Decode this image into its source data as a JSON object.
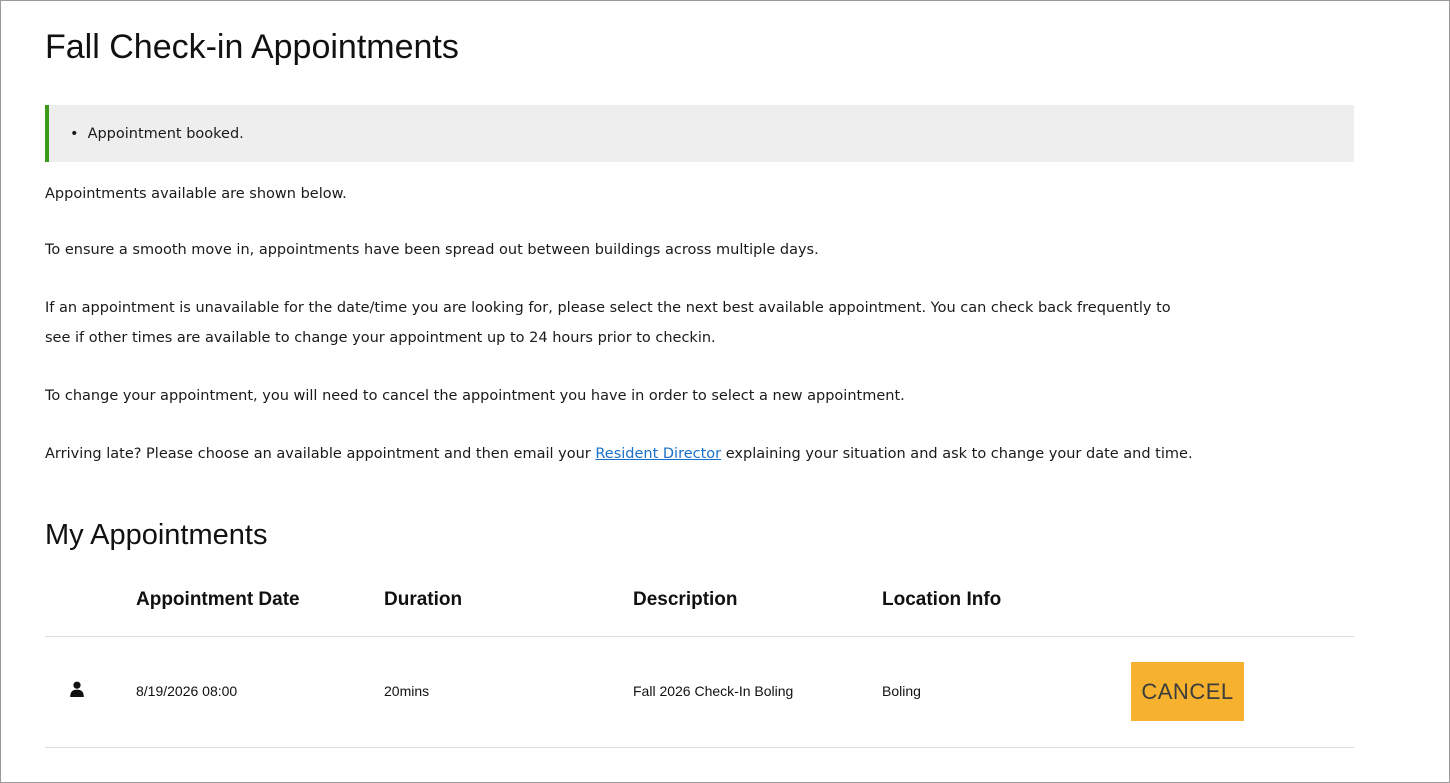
{
  "page": {
    "title": "Fall Check-in Appointments"
  },
  "alert": {
    "messages": [
      "Appointment booked."
    ],
    "bullet": "•",
    "accent_color": "#3c9a1b"
  },
  "intro": {
    "available": "Appointments available are shown below.",
    "spread": "To ensure a smooth move in, appointments have been spread out between buildings across multiple days.",
    "unavailable_line1": "If an appointment is unavailable for the date/time you are looking for, please select the next best available appointment. You can check back frequently to",
    "unavailable_line2": "see if other times are available to change your appointment up to 24 hours prior to checkin.",
    "change": "To change your appointment, you will need to cancel the appointment you have in order to select a new appointment.",
    "late_before": "Arriving late? Please choose an available appointment and then email your ",
    "late_link": "Resident Director",
    "late_after": " explaining your situation and ask to change your date and time."
  },
  "my_appointments": {
    "title": "My Appointments",
    "columns": [
      "Appointment Date",
      "Duration",
      "Description",
      "Location Info"
    ],
    "rows": [
      {
        "icon": "user-icon",
        "date": "8/19/2026 08:00",
        "duration": "20mins",
        "description": "Fall 2026 Check-In Boling",
        "location": "Boling",
        "action_label": "CANCEL"
      }
    ],
    "action_color": "#f6b22e"
  }
}
